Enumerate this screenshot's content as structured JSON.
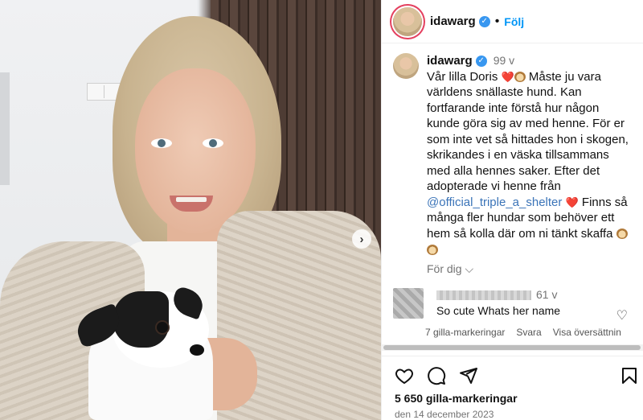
{
  "post": {
    "username": "idawarg",
    "follow_label": "Följ",
    "separator": "•"
  },
  "caption": {
    "username": "idawarg",
    "time": "99 v",
    "line1": "Vår lilla Doris",
    "line1b": "Måste ju vara världens snällaste hund. Kan fortfarande inte förstå hur någon kunde göra sig av med henne. För er som inte vet så hittades hon i skogen, skrikandes i en väska tillsammans med alla hennes saker. Efter det adopterade vi henne från",
    "mention": "@official_triple_a_shelter",
    "line2": "Finns så många fler hundar som behöver ett hem så kolla där om ni tänkt skaffa",
    "for_you": "För dig ⌵"
  },
  "comment": {
    "time": "61 v",
    "text": "So cute Whats her name",
    "likes": "7 gilla-markeringar",
    "reply": "Svara",
    "translate": "Visa översättnin"
  },
  "footer": {
    "likes": "5 650 gilla-markeringar",
    "date": "den 14 december 2023"
  },
  "icons": [
    "heart-icon",
    "comment-icon",
    "share-icon",
    "bookmark-icon",
    "verified-icon",
    "chevron-right-icon"
  ],
  "colors": {
    "follow": "#0095f6",
    "verified": "#3897f0",
    "mention": "#3b74b8",
    "heart": "#e0245e"
  }
}
